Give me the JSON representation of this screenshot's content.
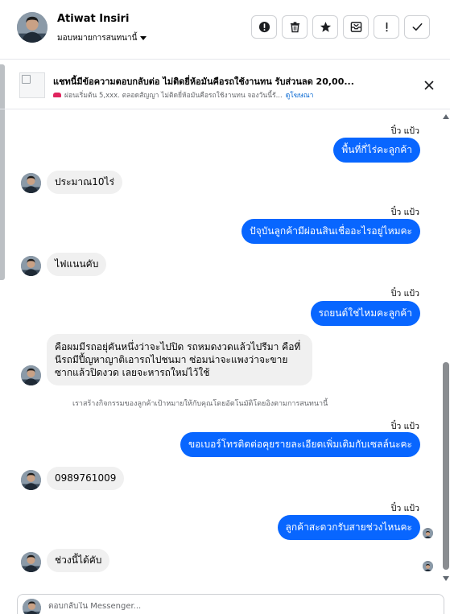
{
  "contact": {
    "name": "Atiwat Insiri",
    "assign_label": "มอบหมายการสนทนานี้",
    "avatar_icon": "person-avatar"
  },
  "toolbar": {
    "buttons": [
      {
        "name": "mark-spam-button",
        "icon": "alert-circle-icon"
      },
      {
        "name": "delete-button",
        "icon": "trash-icon"
      },
      {
        "name": "star-button",
        "icon": "star-icon"
      },
      {
        "name": "archive-button",
        "icon": "archive-icon"
      },
      {
        "name": "important-button",
        "icon": "exclamation-icon"
      },
      {
        "name": "done-button",
        "icon": "check-icon"
      }
    ]
  },
  "ad_banner": {
    "title": "แชทนี้มีข้อความตอบกลับต่อ ไม่ติดยี่ห้อมันคือรถใช้งานทน รับส่วนลด 20,00...",
    "subtitle": "ผ่อนเริ่มต้น 5,xxx. ตลอดสัญญา ไม่ติดยี่ห้อมันคือรถใช้งานทน จองวันนี้รั...",
    "link": "ดูโฆษณา"
  },
  "messages": [
    {
      "dir": "out",
      "sender": "ปิ๋ว แป้ว",
      "text": "พื้นที่กี่ไร่คะลูกค้า"
    },
    {
      "dir": "in",
      "text": "ประมาณ10ไร่"
    },
    {
      "dir": "out",
      "sender": "ปิ๋ว แป้ว",
      "text": "ปัจุบันลูกค้ามีผ่อนสินเชื่ออะไรอยู่ไหมคะ"
    },
    {
      "dir": "in",
      "text": "ไฟแนนคับ"
    },
    {
      "dir": "out",
      "sender": "ปิ๋ว แป้ว",
      "text": "รถยนต์ใช่ไหมคะลูกค้า"
    },
    {
      "dir": "in",
      "text": "คือผมมีรถอยุ่คันหนึ่งว่าจะไปปิด รถหมดงวดแล้วไปรีมา คือที่นีรถมีปี้ญหาญาติเอารถไปชนมา ซ่อมน่าจะแพงว่าจะขายซากแล้วปิดงวด เลยจะหารถใหม่ไว้ใช้"
    },
    {
      "dir": "system",
      "text": "เราสร้างกิจกรรมของลูกค้าเป้าหมายให้กับคุณโดยอัตโนมัติโดยอิงตามการสนทนานี้"
    },
    {
      "dir": "out",
      "sender": "ปิ๋ว แป้ว",
      "text": "ขอเบอร์โทรติดต่อคุยรายละเอียดเพิ่มเติมกับเซลล์นะคะ"
    },
    {
      "dir": "in",
      "text": "0989761009"
    },
    {
      "dir": "out",
      "sender": "ปิ๋ว แป้ว",
      "text": "ลูกค้าสะดวกรับสายช่วงไหนคะ"
    },
    {
      "dir": "in",
      "text": "ช่วงนี้ได้คับ"
    }
  ],
  "composer": {
    "placeholder": "ตอบกลับใน Messenger..."
  },
  "colors": {
    "outgoing_bubble": "#0866ff",
    "incoming_bubble": "#f0f0f0",
    "link": "#0064d1"
  }
}
